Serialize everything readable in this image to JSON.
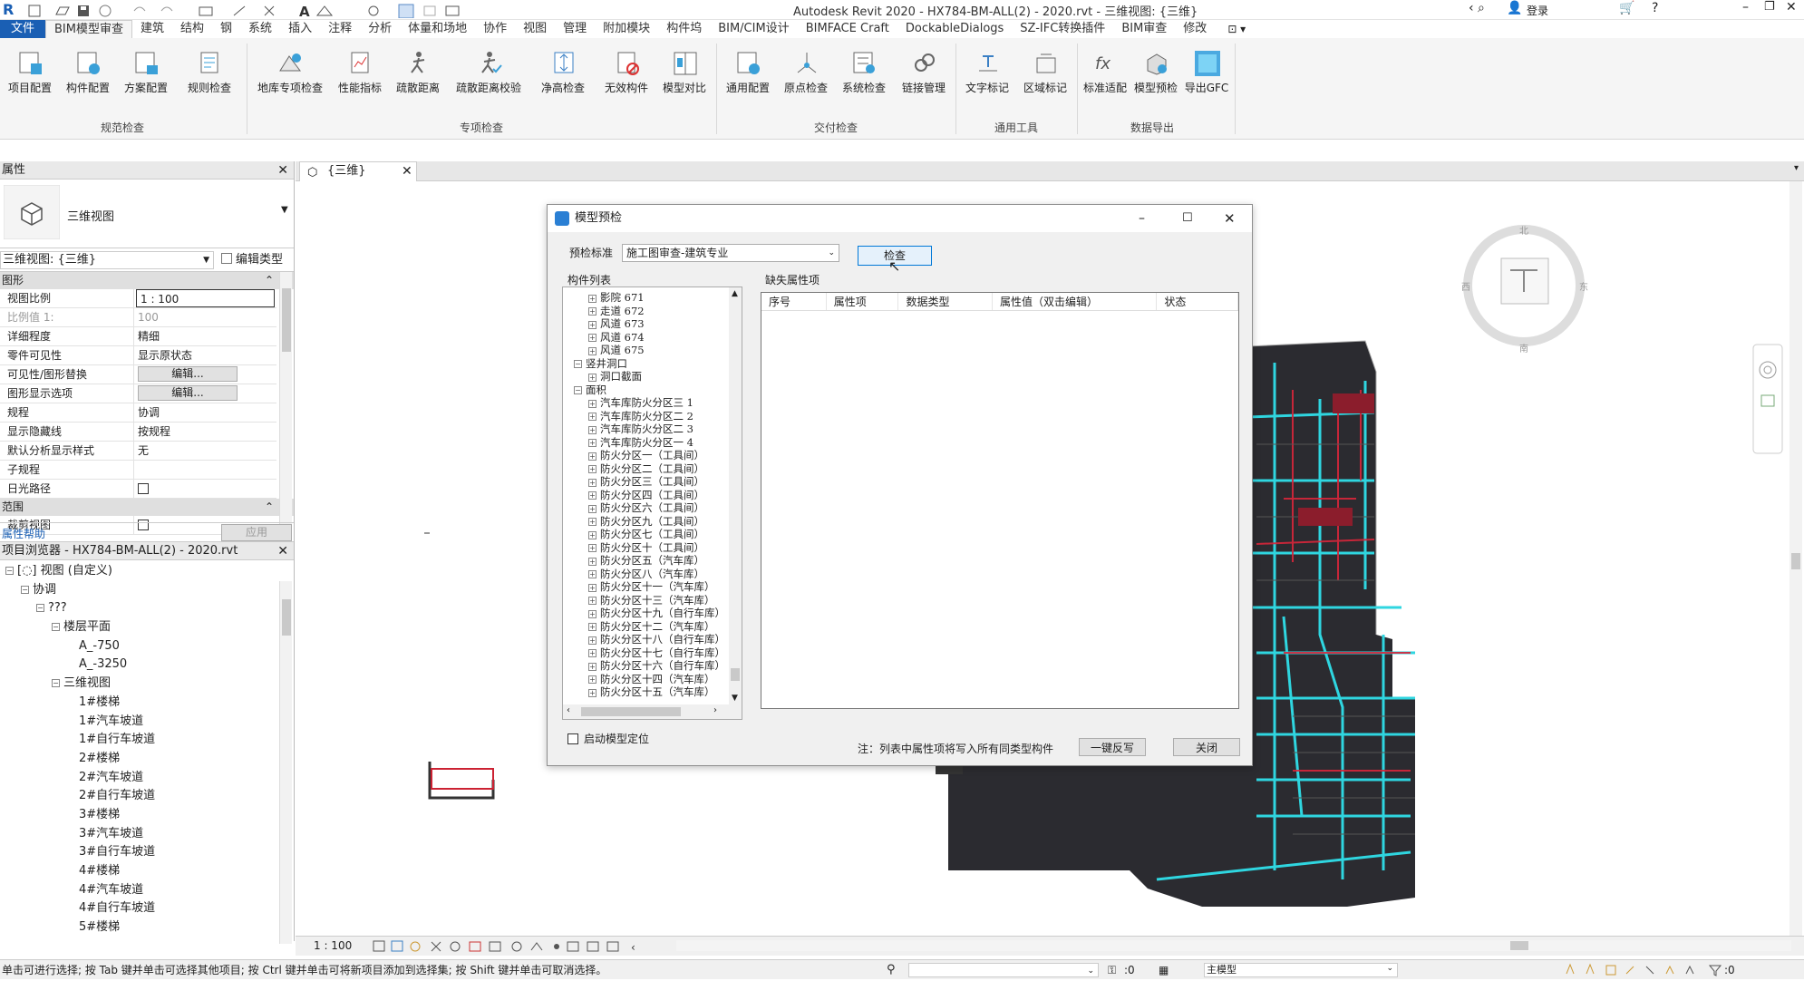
{
  "app": {
    "title": "Autodesk Revit 2020 - HX784-BM-ALL(2) - 2020.rvt - 三维视图: {三维}",
    "login": "登录"
  },
  "ribbon_tabs": [
    "文件",
    "BIM模型审查",
    "建筑",
    "结构",
    "钢",
    "系统",
    "插入",
    "注释",
    "分析",
    "体量和场地",
    "协作",
    "视图",
    "管理",
    "附加模块",
    "构件坞",
    "BIM/CIM设计",
    "BIMFACE Craft",
    "DockableDialogs",
    "SZ-IFC转换插件",
    "BIM审查",
    "修改"
  ],
  "ribbon_groups": {
    "g1": {
      "label": "规范检查",
      "buttons": [
        "项目配置",
        "构件配置",
        "方案配置",
        "规则检查"
      ]
    },
    "g2": {
      "label": "专项检查",
      "buttons": [
        "地库专项检查",
        "性能指标",
        "疏散距离",
        "疏散距离校验",
        "净高检查",
        "无效构件",
        "模型对比"
      ]
    },
    "g3": {
      "label": "交付检查",
      "buttons": [
        "通用配置",
        "原点检查",
        "系统检查",
        "链接管理"
      ]
    },
    "g4": {
      "label": "通用工具",
      "buttons": [
        "文字标记",
        "区域标记"
      ]
    },
    "g5": {
      "label": "数据导出",
      "buttons": [
        "标准适配",
        "模型预检",
        "导出GFC"
      ]
    }
  },
  "properties": {
    "header": "属性",
    "type_name": "三维视图",
    "selector": "三维视图: {三维}",
    "edit_type": "编辑类型",
    "section_graphics": "图形",
    "rows": [
      {
        "k": "视图比例",
        "v": "1 : 100"
      },
      {
        "k": "比例值 1:",
        "v": "100"
      },
      {
        "k": "详细程度",
        "v": "精细"
      },
      {
        "k": "零件可见性",
        "v": "显示原状态"
      },
      {
        "k": "可见性/图形替换",
        "v": "编辑..."
      },
      {
        "k": "图形显示选项",
        "v": "编辑..."
      },
      {
        "k": "规程",
        "v": "协调"
      },
      {
        "k": "显示隐藏线",
        "v": "按规程"
      },
      {
        "k": "默认分析显示样式",
        "v": "无"
      },
      {
        "k": "子规程",
        "v": ""
      },
      {
        "k": "日光路径",
        "v": ""
      }
    ],
    "section_range": "范围",
    "crop_view": "裁剪视图",
    "help": "属性帮助",
    "apply": "应用"
  },
  "browser": {
    "header": "项目浏览器 - HX784-BM-ALL(2) - 2020.rvt",
    "items": [
      {
        "label": "视图 (自定义)",
        "level": 0
      },
      {
        "label": "协调",
        "level": 1
      },
      {
        "label": "???",
        "level": 2
      },
      {
        "label": "楼层平面",
        "level": 3
      },
      {
        "label": "A_-750",
        "level": 4
      },
      {
        "label": "A_-3250",
        "level": 4
      },
      {
        "label": "三维视图",
        "level": 3
      },
      {
        "label": "1#楼梯",
        "level": 4
      },
      {
        "label": "1#汽车坡道",
        "level": 4
      },
      {
        "label": "1#自行车坡道",
        "level": 4
      },
      {
        "label": "2#楼梯",
        "level": 4
      },
      {
        "label": "2#汽车坡道",
        "level": 4
      },
      {
        "label": "2#自行车坡道",
        "level": 4
      },
      {
        "label": "3#楼梯",
        "level": 4
      },
      {
        "label": "3#汽车坡道",
        "level": 4
      },
      {
        "label": "3#自行车坡道",
        "level": 4
      },
      {
        "label": "4#楼梯",
        "level": 4
      },
      {
        "label": "4#汽车坡道",
        "level": 4
      },
      {
        "label": "4#自行车坡道",
        "level": 4
      },
      {
        "label": "5#楼梯",
        "level": 4
      }
    ]
  },
  "view_tab": "{三维}",
  "dialog": {
    "title": "模型预检",
    "std_label": "预检标准",
    "std_value": "施工图审查-建筑专业",
    "check_button": "检查",
    "comp_list_label": "构件列表",
    "missing_label": "缺失属性项",
    "table_headers": [
      "序号",
      "属性项",
      "数据类型",
      "属性值（双击编辑）",
      "状态"
    ],
    "tree": [
      {
        "label": "影院 671",
        "level": 1
      },
      {
        "label": "走道 672",
        "level": 1
      },
      {
        "label": "风道 673",
        "level": 1
      },
      {
        "label": "风道 674",
        "level": 1
      },
      {
        "label": "风道 675",
        "level": 1
      },
      {
        "label": "竖井洞口",
        "level": 0
      },
      {
        "label": "洞口截面",
        "level": 1
      },
      {
        "label": "面积",
        "level": 0
      },
      {
        "label": "汽车库防火分区三 1",
        "level": 1
      },
      {
        "label": "汽车库防火分区二 2",
        "level": 1
      },
      {
        "label": "汽车库防火分区二 3",
        "level": 1
      },
      {
        "label": "汽车库防火分区一 4",
        "level": 1
      },
      {
        "label": "防火分区一（工具间）",
        "level": 1
      },
      {
        "label": "防火分区二（工具间）",
        "level": 1
      },
      {
        "label": "防火分区三（工具间）",
        "level": 1
      },
      {
        "label": "防火分区四（工具间）",
        "level": 1
      },
      {
        "label": "防火分区六（工具间）",
        "level": 1
      },
      {
        "label": "防火分区九（工具间）",
        "level": 1
      },
      {
        "label": "防火分区七（工具间）",
        "level": 1
      },
      {
        "label": "防火分区十（工具间）",
        "level": 1
      },
      {
        "label": "防火分区五（汽车库）",
        "level": 1
      },
      {
        "label": "防火分区八（汽车库）",
        "level": 1
      },
      {
        "label": "防火分区十一（汽车库）",
        "level": 1
      },
      {
        "label": "防火分区十三（汽车库）",
        "level": 1
      },
      {
        "label": "防火分区十九（自行车库）",
        "level": 1
      },
      {
        "label": "防火分区十二（汽车库）",
        "level": 1
      },
      {
        "label": "防火分区十八（自行车库）",
        "level": 1
      },
      {
        "label": "防火分区十七（自行车库）",
        "level": 1
      },
      {
        "label": "防火分区十六（自行车库）",
        "level": 1
      },
      {
        "label": "防火分区十四（汽车库）",
        "level": 1
      },
      {
        "label": "防火分区十五（汽车库）",
        "level": 1
      }
    ],
    "locate_checkbox": "启动模型定位",
    "note": "注：列表中属性项将写入所有同类型构件",
    "writeback_button": "一键反写",
    "close_button": "关闭"
  },
  "viewbar": {
    "scale": "1 : 100"
  },
  "status": {
    "hint": "单击可进行选择; 按 Tab 键并单击可选择其他项目; 按 Ctrl 键并单击可将新项目添加到选择集; 按 Shift 键并单击可取消选择。",
    "zero1": ":0",
    "model": "主模型",
    "zero2": ":0"
  },
  "colors": {
    "accent": "#1a5fb4",
    "model_cyan": "#2fd6e0",
    "model_red": "#d8263a",
    "model_dark": "#2a2a2e"
  }
}
